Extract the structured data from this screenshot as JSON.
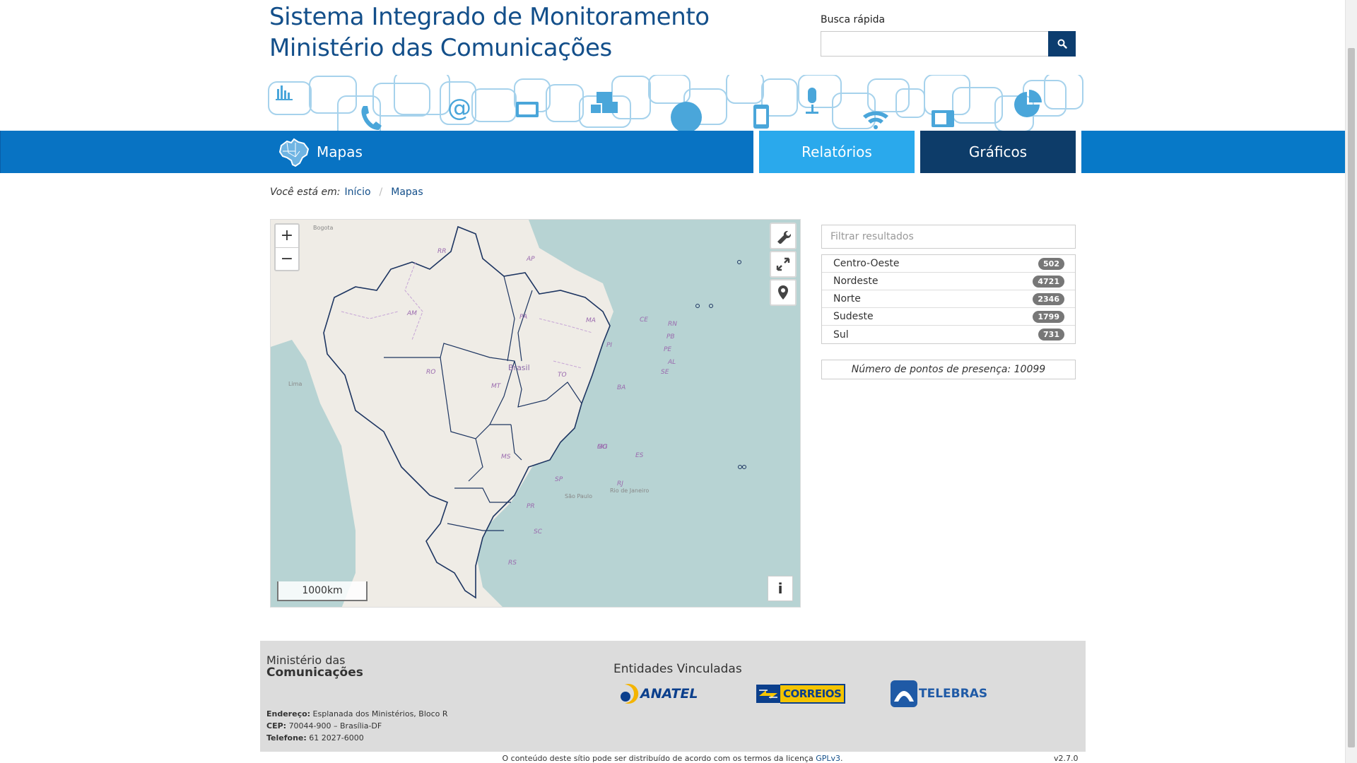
{
  "header": {
    "title_line1": "Sistema Integrado de Monitoramento",
    "title_line2": "Ministério das Comunicações",
    "quick_search_label": "Busca rápida",
    "quick_search_value": "",
    "quick_search_placeholder": ""
  },
  "nav": {
    "mapas": "Mapas",
    "relatorios": "Relatórios",
    "graficos": "Gráficos"
  },
  "breadcrumb": {
    "label": "Você está em:",
    "items": [
      "Início",
      "Mapas"
    ]
  },
  "map": {
    "zoom_in": "+",
    "zoom_out": "−",
    "scale": "1000km",
    "info": "i",
    "states": [
      "RR",
      "AP",
      "AM",
      "PA",
      "MA",
      "CE",
      "RN",
      "PB",
      "PE",
      "AL",
      "SE",
      "PI",
      "TO",
      "BA",
      "RO",
      "MT",
      "MS",
      "GO",
      "MG",
      "ES",
      "SP",
      "RJ",
      "PR",
      "SC",
      "RS"
    ],
    "country_label": "Brasil",
    "cities": [
      "Bogota",
      "Lima",
      "São Paulo",
      "Rio de Janeiro"
    ]
  },
  "filter": {
    "placeholder": "Filtrar resultados"
  },
  "regions": [
    {
      "name": "Centro-Oeste",
      "count": "502"
    },
    {
      "name": "Nordeste",
      "count": "4721"
    },
    {
      "name": "Norte",
      "count": "2346"
    },
    {
      "name": "Sudeste",
      "count": "1799"
    },
    {
      "name": "Sul",
      "count": "731"
    }
  ],
  "presence": "Número de pontos de presença: 10099",
  "footer": {
    "logo_line1": "Ministério das",
    "logo_line2": "Comunicações",
    "address_label": "Endereço:",
    "address_value": "Esplanada dos Ministérios, Bloco R",
    "cep_label": "CEP:",
    "cep_value": "70044-900 – Brasília-DF",
    "phone_label": "Telefone:",
    "phone_value": "61 2027-6000",
    "entidades_title": "Entidades Vinculadas",
    "anatel": "ANATEL",
    "correios": "CORREIOS",
    "telebras": "TELEBRAS"
  },
  "license": {
    "text_before": "O conteúdo deste sítio pode ser distribuído de acordo com os termos da licença ",
    "link": "GPLv3",
    "text_after": "."
  },
  "version": "v2.7.0",
  "colors": {
    "primary": "#0779c8",
    "dark": "#0d3c69",
    "light": "#2aa9ec",
    "title": "#134f8a",
    "ocean": "#b7d3d3",
    "land": "#efece6"
  }
}
